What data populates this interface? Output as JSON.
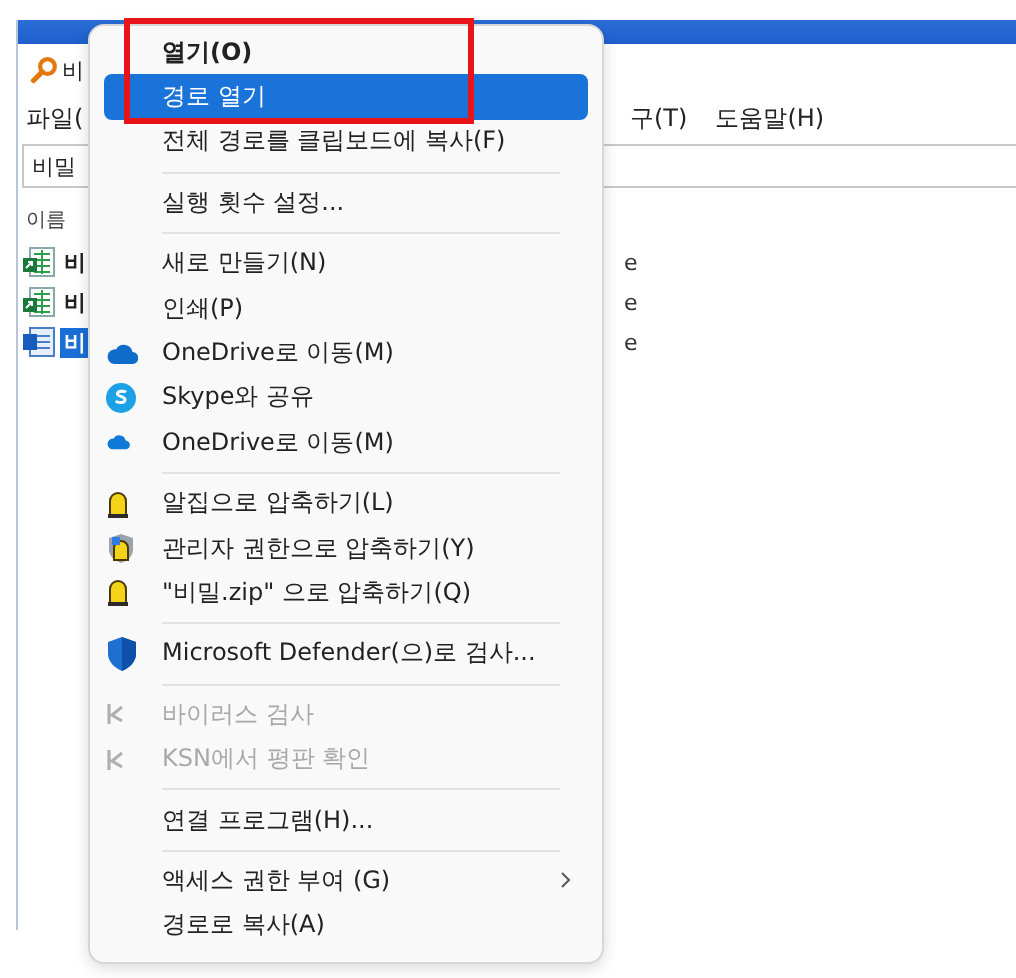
{
  "window": {
    "title": "비"
  },
  "menu_bar": [
    {
      "label": "파일("
    },
    {
      "label": "구(T)"
    },
    {
      "label": "도움말(H)"
    }
  ],
  "address_bar": {
    "value": "비밀"
  },
  "file_list": {
    "column_1": "이름",
    "rows": [
      {
        "name": "비",
        "kind": "shortcut",
        "selected": false,
        "column_2": "e"
      },
      {
        "name": "비",
        "kind": "shortcut",
        "selected": false,
        "column_2": "e"
      },
      {
        "name": "비",
        "kind": "document",
        "selected": true,
        "column_2": "e"
      }
    ]
  },
  "context_menu": [
    {
      "kind": "item",
      "label": "열기(O)",
      "bold": true,
      "selected": false
    },
    {
      "kind": "item",
      "label": "경로 열기",
      "selected": true
    },
    {
      "kind": "item",
      "label": "전체 경로를 클립보드에 복사(F)",
      "selected": false
    },
    {
      "kind": "separator"
    },
    {
      "kind": "item",
      "label": "실행 횟수 설정...",
      "selected": false
    },
    {
      "kind": "separator"
    },
    {
      "kind": "item",
      "label": "새로 만들기(N)",
      "selected": false
    },
    {
      "kind": "item",
      "label": "인쇄(P)",
      "selected": false
    },
    {
      "kind": "cloud",
      "label": "OneDrive로 이동(M)",
      "selected": false
    },
    {
      "kind": "skype",
      "label": "Skype와 공유",
      "selected": false
    },
    {
      "kind": "smallcloud",
      "label": "OneDrive로 이동(M)",
      "selected": false
    },
    {
      "kind": "separator"
    },
    {
      "kind": "archive",
      "label": "알집으로 압축하기(L)",
      "selected": false
    },
    {
      "kind": "admin",
      "label": "관리자 권한으로 압축하기(Y)",
      "selected": false
    },
    {
      "kind": "archive",
      "label": "\"비밀.zip\" 으로 압축하기(Q)",
      "selected": false
    },
    {
      "kind": "separator"
    },
    {
      "kind": "shield",
      "label": "Microsoft Defender(으)로 검사...",
      "selected": false
    },
    {
      "kind": "separator"
    },
    {
      "kind": "antivirus",
      "label": "바이러스 검사",
      "disabled": true,
      "selected": false
    },
    {
      "kind": "antivirus",
      "label": "KSN에서 평판 확인",
      "disabled": true,
      "selected": false
    },
    {
      "kind": "separator"
    },
    {
      "kind": "item",
      "label": "연결 프로그램(H)...",
      "selected": false
    },
    {
      "kind": "separator"
    },
    {
      "kind": "item",
      "label": "액세스 권한 부여 (G)",
      "submenu": true,
      "selected": false
    },
    {
      "kind": "item",
      "label": "경로로 복사(A)",
      "selected": false
    }
  ]
}
